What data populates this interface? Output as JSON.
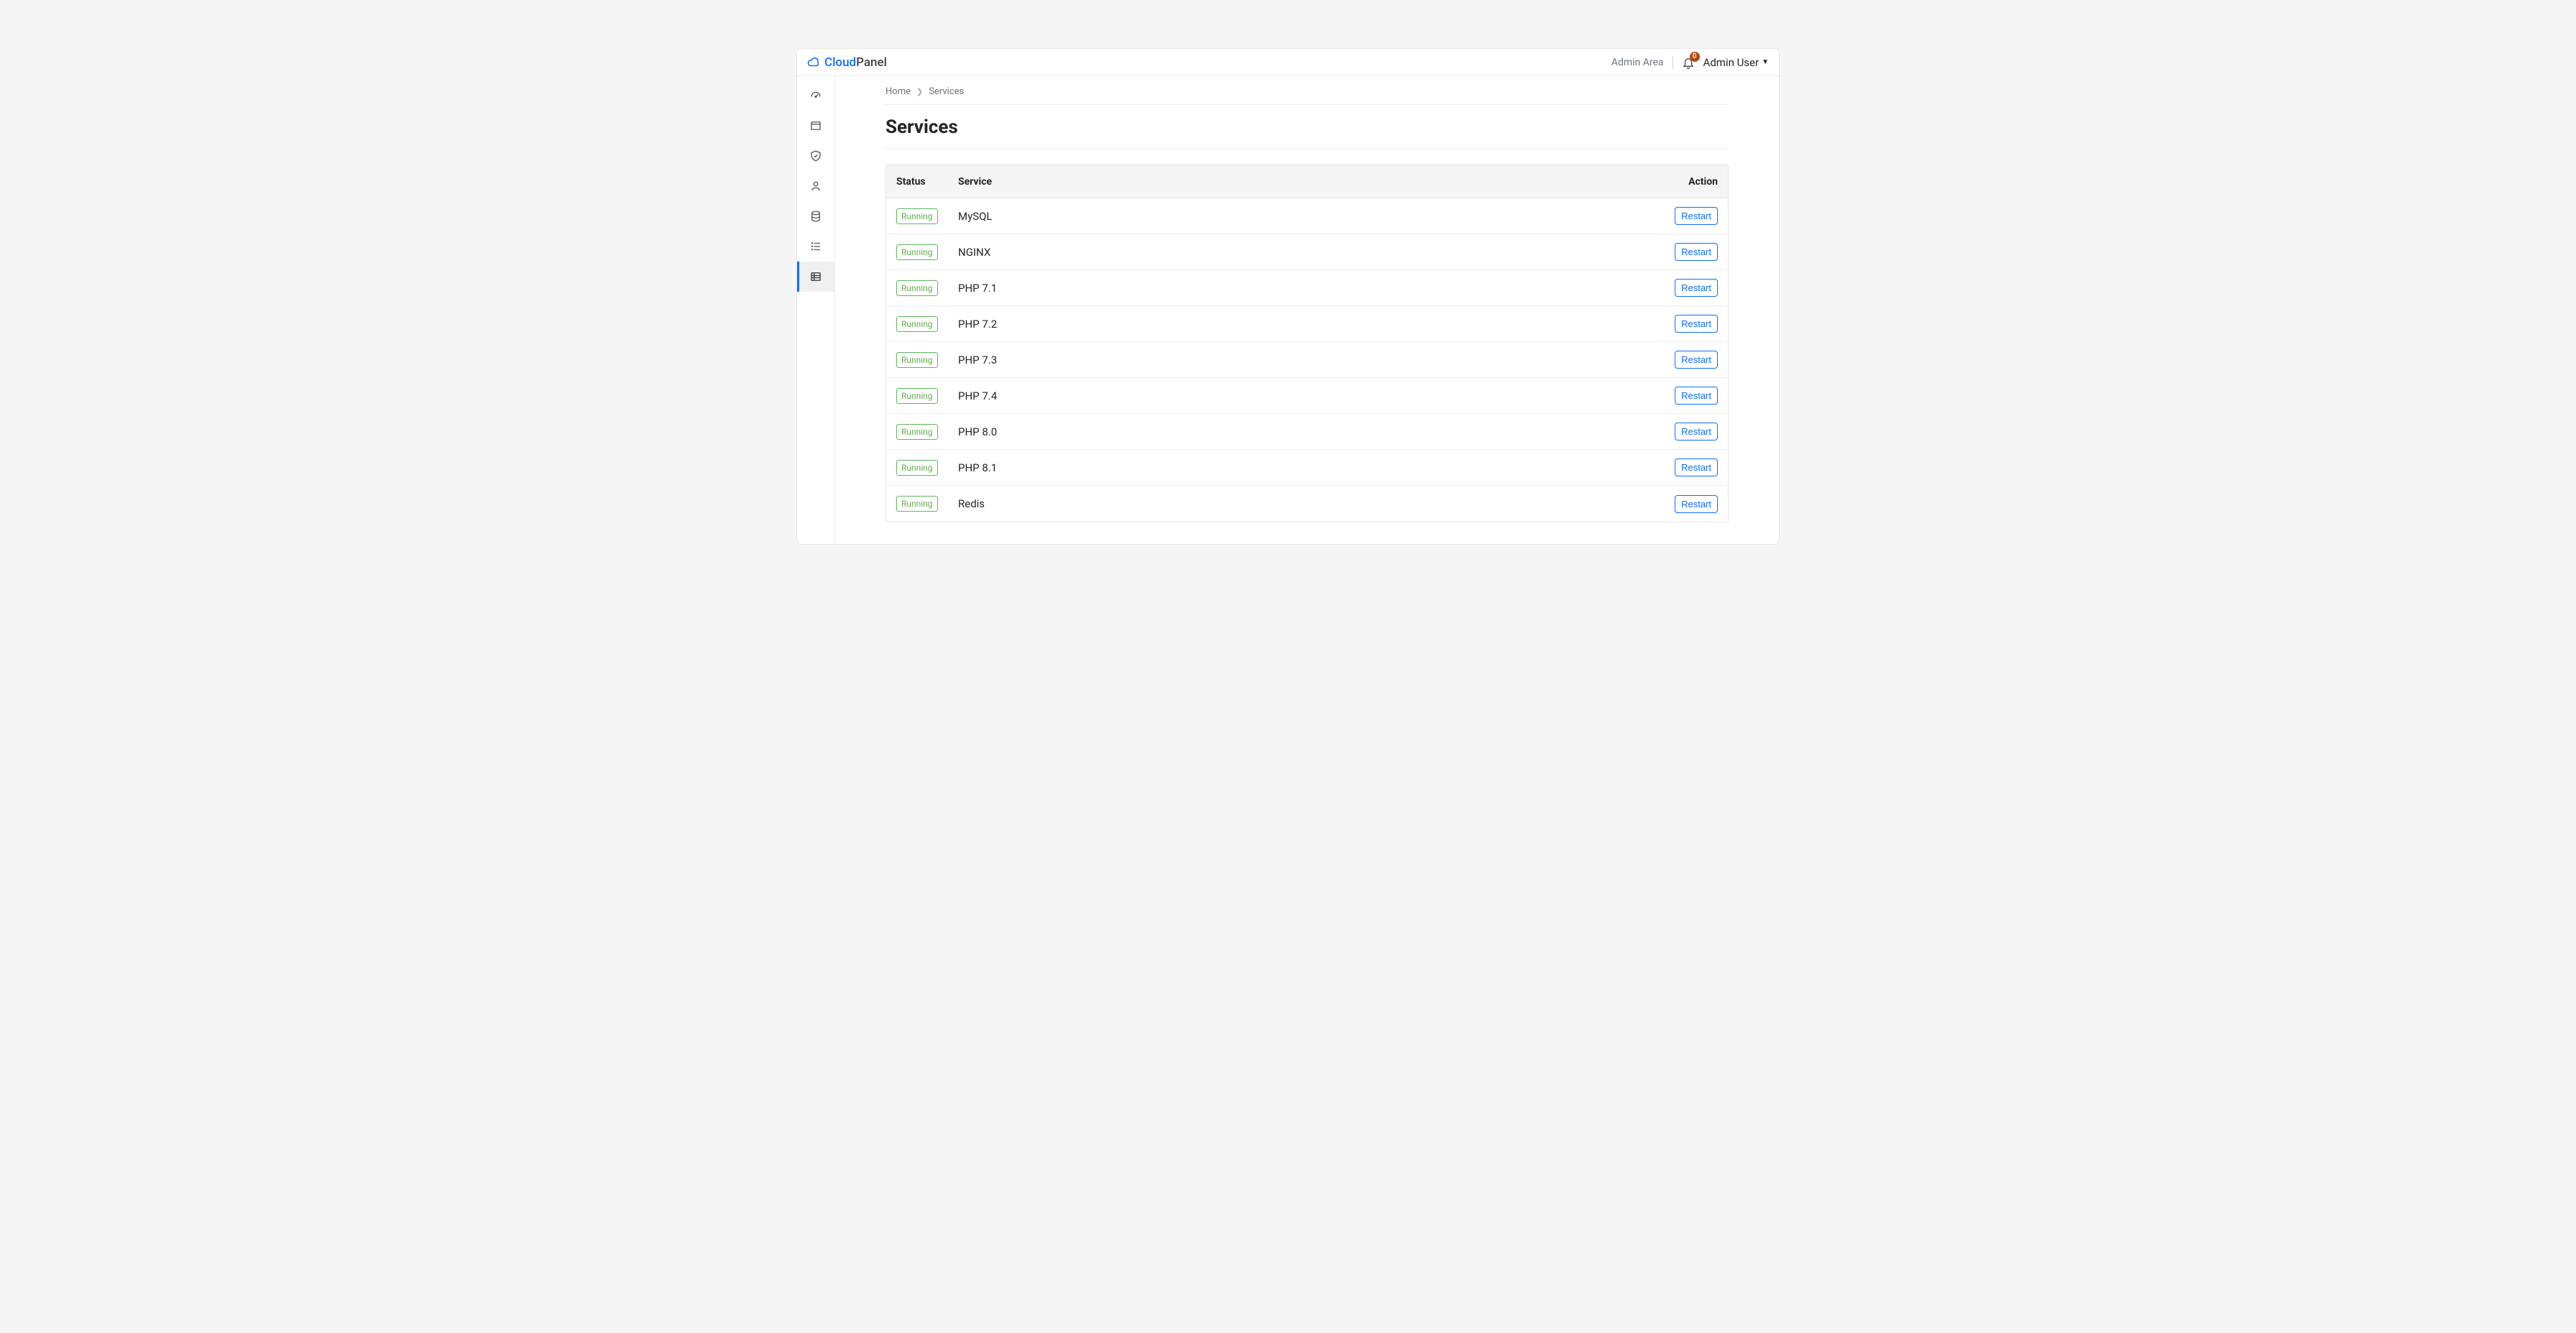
{
  "brand": {
    "name_part1": "Cloud",
    "name_part2": "Panel"
  },
  "topbar": {
    "admin_area": "Admin Area",
    "notifications_count": "0",
    "user_name": "Admin User"
  },
  "breadcrumbs": {
    "home": "Home",
    "current": "Services"
  },
  "page": {
    "title": "Services"
  },
  "table": {
    "headers": {
      "status": "Status",
      "service": "Service",
      "action": "Action"
    },
    "restart_label": "Restart",
    "status_label_running": "Running",
    "rows": [
      {
        "status": "Running",
        "name": "MySQL"
      },
      {
        "status": "Running",
        "name": "NGINX"
      },
      {
        "status": "Running",
        "name": "PHP 7.1"
      },
      {
        "status": "Running",
        "name": "PHP 7.2"
      },
      {
        "status": "Running",
        "name": "PHP 7.3"
      },
      {
        "status": "Running",
        "name": "PHP 7.4"
      },
      {
        "status": "Running",
        "name": "PHP 8.0"
      },
      {
        "status": "Running",
        "name": "PHP 8.1"
      },
      {
        "status": "Running",
        "name": "Redis"
      }
    ]
  },
  "sidebar": {
    "items": [
      {
        "id": "dashboard"
      },
      {
        "id": "sites"
      },
      {
        "id": "security"
      },
      {
        "id": "users"
      },
      {
        "id": "databases"
      },
      {
        "id": "cron"
      },
      {
        "id": "services",
        "active": true
      }
    ]
  }
}
